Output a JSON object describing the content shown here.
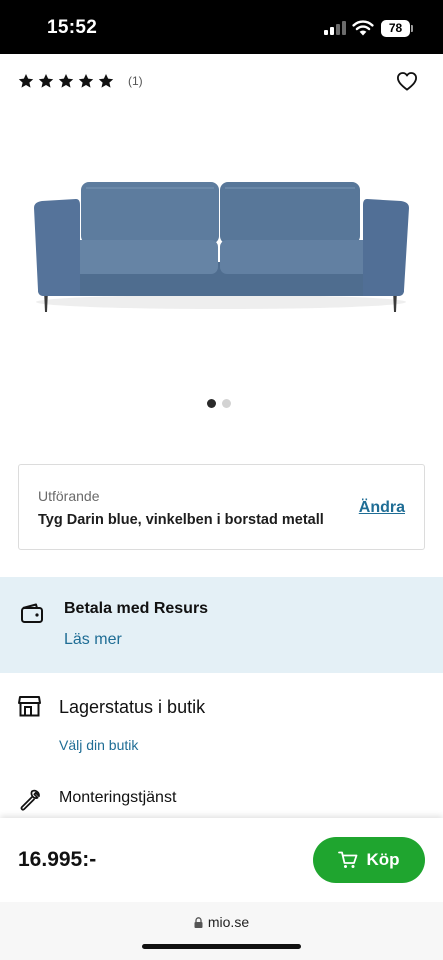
{
  "status_bar": {
    "time": "15:52",
    "battery": "78"
  },
  "rating": {
    "stars": 5,
    "count": "(1)"
  },
  "gallery": {
    "total": 2,
    "active": 1
  },
  "variant": {
    "label": "Utförande",
    "value": "Tyg Darin blue, vinkelben i borstad metall",
    "change": "Ändra"
  },
  "payment": {
    "title": "Betala med Resurs",
    "link": "Läs mer"
  },
  "stock": {
    "title": "Lagerstatus i butik",
    "link": "Välj din butik"
  },
  "assembly": {
    "title": "Monteringstjänst"
  },
  "buy_bar": {
    "price": "16.995:-",
    "button": "Köp"
  },
  "browser": {
    "url": "mio.se"
  },
  "colors": {
    "accent_blue": "#1f6d95",
    "buy_green": "#1fa52f",
    "payment_band": "#e4f0f6",
    "sofa": "#5d7c9e"
  },
  "icons": [
    "star-icon",
    "heart-icon",
    "wallet-icon",
    "store-icon",
    "wrench-icon",
    "cart-icon",
    "lock-icon"
  ]
}
